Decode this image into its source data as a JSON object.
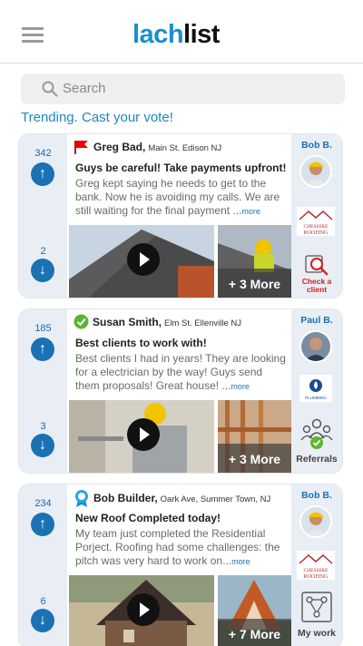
{
  "header": {
    "logo_part1": "lach",
    "logo_part2": "list"
  },
  "search": {
    "placeholder": "Search"
  },
  "trending": "Trending. Cast your vote!",
  "posts": [
    {
      "upvotes": "342",
      "downvotes": "2",
      "badge": "flag-icon",
      "author": "Greg Bad,",
      "location": "Main St. Edison NJ",
      "title": "Guys be careful! Take payments upfront!",
      "body": "Greg kept saying he needs to get to the bank. Now he is avoiding my calls. We are still waiting for the final payment ...",
      "more": "more",
      "more_images": "+ 3 More",
      "side_user": "Bob B.",
      "side_logo_line1": "CHESHIRE",
      "side_logo_line2": "ROOFING",
      "side_action": "Check a client",
      "accent": "#1a72b3"
    },
    {
      "upvotes": "185",
      "downvotes": "3",
      "badge": "check-icon",
      "author": "Susan Smith,",
      "location": "Elm St. Ellenville NJ",
      "title": "Best clients to work with!",
      "body": "Best clients I had in years! They are looking for a electrician by the way! Guys send them proposals! Great house! ...",
      "more": "more",
      "more_images": "+ 3 More",
      "side_user": "Paul B.",
      "side_logo_line1": "PLUMBING",
      "side_logo_line2": "",
      "side_action": "Referrals",
      "accent": "#1a72b3"
    },
    {
      "upvotes": "234",
      "downvotes": "6",
      "badge": "award-icon",
      "author": "Bob Builder,",
      "location": "Oark Ave, Summer Town, NJ",
      "title": "New Roof Completed today!",
      "body": "My team just completed the Residential Porject. Roofing had some challenges: the pitch was very hard to work on...",
      "more": "more",
      "more_images": "+ 7 More",
      "side_user": "Bob B.",
      "side_logo_line1": "CHESHIRE",
      "side_logo_line2": "ROOFING",
      "side_action": "My work",
      "accent": "#1a72b3"
    }
  ]
}
